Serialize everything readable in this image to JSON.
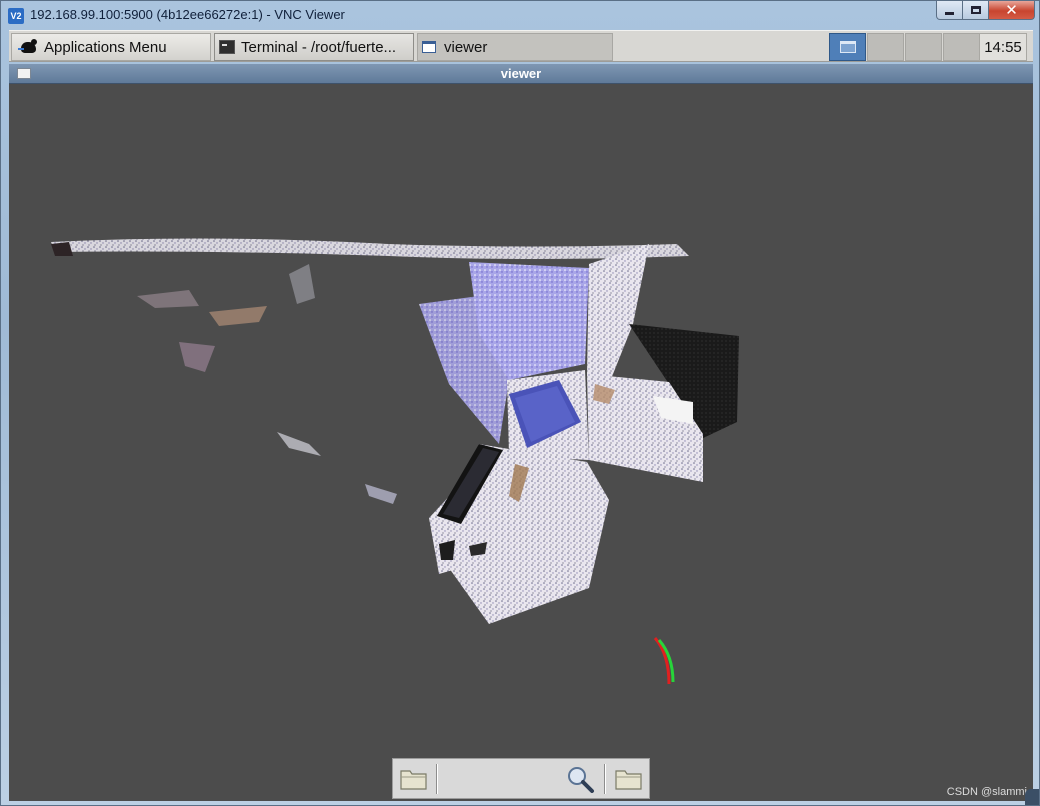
{
  "window": {
    "title": "192.168.99.100:5900 (4b12ee66272e:1) - VNC Viewer",
    "icon": "vnc-icon",
    "icon_text": "V2"
  },
  "panel": {
    "app_menu_label": "Applications Menu",
    "tasks": [
      {
        "label": "Terminal - /root/fuerte...",
        "icon": "terminal-icon"
      },
      {
        "label": "viewer",
        "icon": "window-icon"
      }
    ],
    "workspaces": 4,
    "active_workspace": 1,
    "clock": "14:55"
  },
  "viewer": {
    "title": "viewer",
    "background_color": "#4c4c4c"
  },
  "toolbar": {
    "buttons": [
      "open-folder-icon",
      "zoom-icon",
      "folder-icon"
    ]
  },
  "watermark": "CSDN @slammi"
}
